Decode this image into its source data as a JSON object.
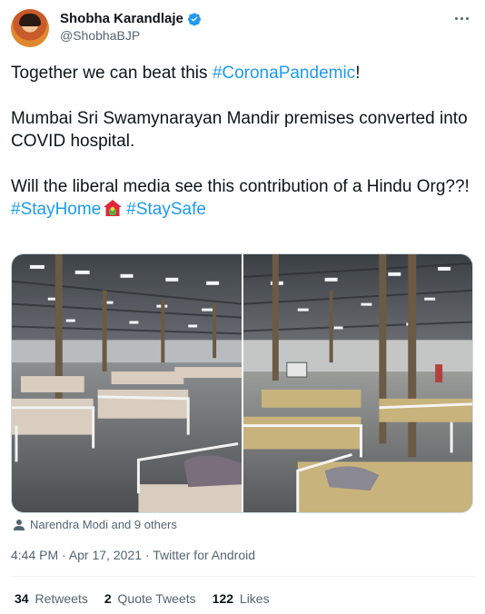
{
  "author": {
    "name": "Shobha Karandlaje",
    "handle": "@ShobhaBJP"
  },
  "tweet": {
    "line1_prefix": "Together we can beat this ",
    "line1_hashtag": "#CoronaPandemic",
    "line1_suffix": "!",
    "line2": "Mumbai Sri Swamynarayan Mandir premises converted into COVID hospital.",
    "line3": "Will the liberal media see this contribution of a Hindu Org??!",
    "hashtag_stayhome": "#StayHome",
    "hashtag_staysafe": "#StaySafe"
  },
  "media": {
    "photos": [
      "hospital-hall-left",
      "hospital-hall-right"
    ]
  },
  "liked_by": "Narendra Modi and 9 others",
  "meta": {
    "time": "4:44 PM",
    "separator1": " · ",
    "date": "Apr 17, 2021",
    "separator2": " · ",
    "source": "Twitter for Android"
  },
  "stats": {
    "retweets_count": "34",
    "retweets_label": "Retweets",
    "quotes_count": "2",
    "quotes_label": "Quote Tweets",
    "likes_count": "122",
    "likes_label": "Likes"
  },
  "colors": {
    "accent": "#1d9bf0",
    "secondary_text": "#536471",
    "primary_text": "#0f1419"
  }
}
